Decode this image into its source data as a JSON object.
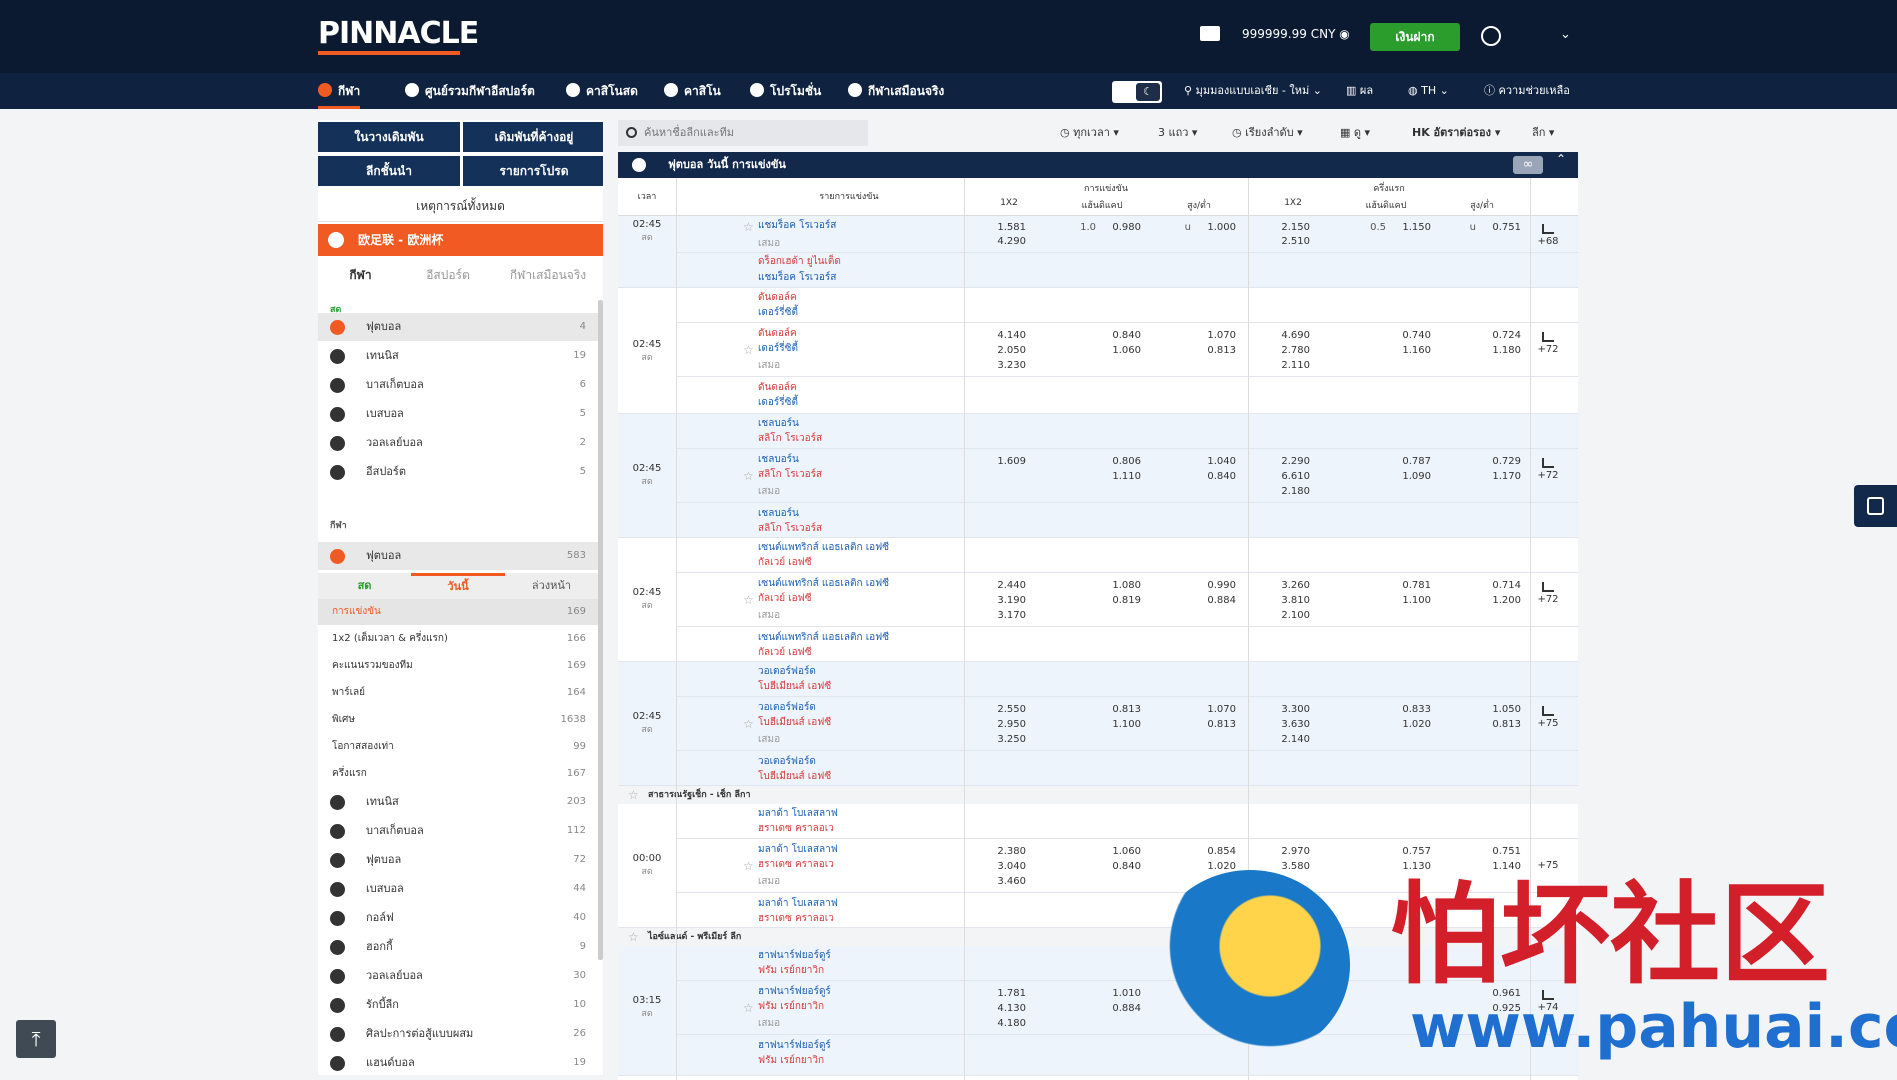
{
  "header": {
    "logo": "PINNACLE",
    "balance": "999999.99 CNY",
    "deposit": "เงินฝาก"
  },
  "nav": {
    "items": [
      "กีฬา",
      "ศูนย์รวมกีฬาอีสปอร์ต",
      "คาสิโนสด",
      "คาสิโน",
      "โปรโมชั่น",
      "กีฬาเสมือนจริง"
    ],
    "view": "มุมมองแบบเอเชีย - ใหม่",
    "results": "ผล",
    "lang": "TH",
    "help": "ความช่วยเหลือ"
  },
  "sidebar": {
    "buttons": [
      "ในวางเดิมพัน",
      "เดิมพันที่ค้างอยู่",
      "ลีกชั้นนำ",
      "รายการโปรด"
    ],
    "all_events": "เหตุการณ์ทั้งหมด",
    "league": "欧足联 - 欧洲杯",
    "tabs": [
      "กีฬา",
      "อีสปอร์ต",
      "กีฬาเสมือนจริง"
    ],
    "live_head": "สด",
    "live": [
      {
        "label": "ฟุตบอล",
        "count": "4"
      },
      {
        "label": "เทนนิส",
        "count": "19"
      },
      {
        "label": "บาสเก็ตบอล",
        "count": "6"
      },
      {
        "label": "เบสบอล",
        "count": "5"
      },
      {
        "label": "วอลเลย์บอล",
        "count": "2"
      },
      {
        "label": "อีสปอร์ต",
        "count": "5"
      }
    ],
    "sport_head": "กีฬา",
    "football": {
      "label": "ฟุตบอล",
      "count": "583"
    },
    "market_tabs": [
      "สด",
      "วันนี้",
      "ล่วงหน้า"
    ],
    "markets": [
      {
        "label": "การแข่งขัน",
        "count": "169"
      },
      {
        "label": "1x2 (เต็มเวลา & ครึ่งแรก)",
        "count": "166"
      },
      {
        "label": "คะแนนรวมของทีม",
        "count": "169"
      },
      {
        "label": "พาร์เลย์",
        "count": "164"
      },
      {
        "label": "พิเศษ",
        "count": "1638"
      },
      {
        "label": "โอกาสสองเท่า",
        "count": "99"
      },
      {
        "label": "ครึ่งแรก",
        "count": "167"
      }
    ],
    "others": [
      {
        "label": "เทนนิส",
        "count": "203"
      },
      {
        "label": "บาสเก็ตบอล",
        "count": "112"
      },
      {
        "label": "ฟุตบอล",
        "count": "72"
      },
      {
        "label": "เบสบอล",
        "count": "44"
      },
      {
        "label": "กอล์ฟ",
        "count": "40"
      },
      {
        "label": "ฮอกกี้",
        "count": "9"
      },
      {
        "label": "วอลเลย์บอล",
        "count": "30"
      },
      {
        "label": "รักบี้ลีก",
        "count": "10"
      },
      {
        "label": "ศิลปะการต่อสู้แบบผสม",
        "count": "26"
      },
      {
        "label": "แฮนด์บอล",
        "count": "19"
      }
    ]
  },
  "toolbar": {
    "search_placeholder": "ค้นหาชื่อลีกและทีม",
    "time": "ทุกเวลา",
    "rows": "3 แถว",
    "sort": "เรียงลำดับ",
    "view": "ดู",
    "odds": "HK อัตราต่อรอง",
    "league": "ลีก"
  },
  "main": {
    "section": "ฟุตบอล วันนี้ การแข่งขัน",
    "inf": "∞",
    "cols": {
      "time": "เวลา",
      "match": "รายการแข่งขัน",
      "full": "การแข่งขัน",
      "half": "ครึ่งแรก",
      "c1": "1X2",
      "c2": "แฮ้นดิแคป",
      "c3": "สูง/ต่ำ"
    },
    "draw": "เสมอ",
    "live": "สด",
    "leagues": [
      "สาธารณรัฐเช็ก - เช็ก ลีกา",
      "ไอซ์แลนด์ - พรีเมียร์ ลีก"
    ],
    "blocks": [
      {
        "time": "02:45",
        "more": "+68"
      },
      {
        "time": "02:45",
        "more": "+72"
      },
      {
        "time": "02:45",
        "more": "+72"
      },
      {
        "time": "02:45",
        "more": "+72"
      },
      {
        "time": "02:45",
        "more": "+75"
      },
      {
        "time": "00:00",
        "more": "+75"
      },
      {
        "time": "03:15",
        "more": "+74"
      }
    ],
    "teams": {
      "b0": [
        "แชมร็อค โรเวอร์ส",
        "ดร็อกเฮด้า ยูไนเต็ด",
        "แชมร็อค โรเวอร์ส"
      ],
      "b1": [
        "ดันดอล์ค",
        "เดอร์รี่ซิตี้"
      ],
      "b2": [
        "เชลบอร์น",
        "สลิโก โรเวอร์ส"
      ],
      "b3": [
        "เซนต์แพทริกส์ แอธเลติก เอฟซี",
        "กัลเวย์ เอฟซี"
      ],
      "b4": [
        "วอเตอร์ฟอร์ด",
        "โบฮีเมียนส์ เอฟซี"
      ],
      "b5": [
        "มลาด้า โบเลสลาฟ",
        "ฮราเดซ คราลอเว"
      ],
      "b6": [
        "ฮาฟนาร์ฟยอร์ดูร์",
        "ฟรัม เรย์กยาวิก"
      ]
    },
    "odds": {
      "b1a": [
        "1.581",
        "4.290",
        "1.0",
        "0.980",
        "u",
        "1.000",
        "2.150",
        "2.510",
        "0.5",
        "1.150",
        "u",
        "0.751"
      ],
      "b2a": [
        "4.140",
        "2.050",
        "3.230",
        "0.840",
        "1.060",
        "1.070",
        "0.813",
        "4.690",
        "2.780",
        "2.110",
        "0.740",
        "1.160",
        "0.724",
        "1.180"
      ],
      "b3a": [
        "1.609",
        "0.806",
        "1.110",
        "1.040",
        "0.840",
        "2.290",
        "6.610",
        "2.180",
        "0.787",
        "1.090",
        "0.729",
        "1.170"
      ],
      "b4a": [
        "2.440",
        "3.190",
        "3.170",
        "1.080",
        "0.819",
        "0.990",
        "0.884",
        "3.260",
        "3.810",
        "2.100",
        "0.781",
        "1.100",
        "0.714",
        "1.200"
      ],
      "b5a": [
        "2.550",
        "2.950",
        "3.250",
        "0.813",
        "1.100",
        "1.070",
        "0.813",
        "3.300",
        "3.630",
        "2.140",
        "0.833",
        "1.020",
        "1.050",
        "0.813"
      ],
      "b6a": [
        "2.380",
        "3.040",
        "3.460",
        "1.060",
        "0.840",
        "0.854",
        "1.020",
        "2.970",
        "3.580",
        "0.757",
        "1.130",
        "0.751",
        "1.140"
      ],
      "b7a": [
        "1.781",
        "4.130",
        "4.180",
        "1.010",
        "0.884",
        "0.961",
        "0.925"
      ]
    }
  },
  "watermark": {
    "title": "怕坏社区",
    "url": "www.pahuai.com"
  },
  "icons": [
    "mail-icon",
    "user-icon",
    "soccer-icon",
    "search-icon",
    "star-icon",
    "chart-icon",
    "arrow-up-icon"
  ]
}
